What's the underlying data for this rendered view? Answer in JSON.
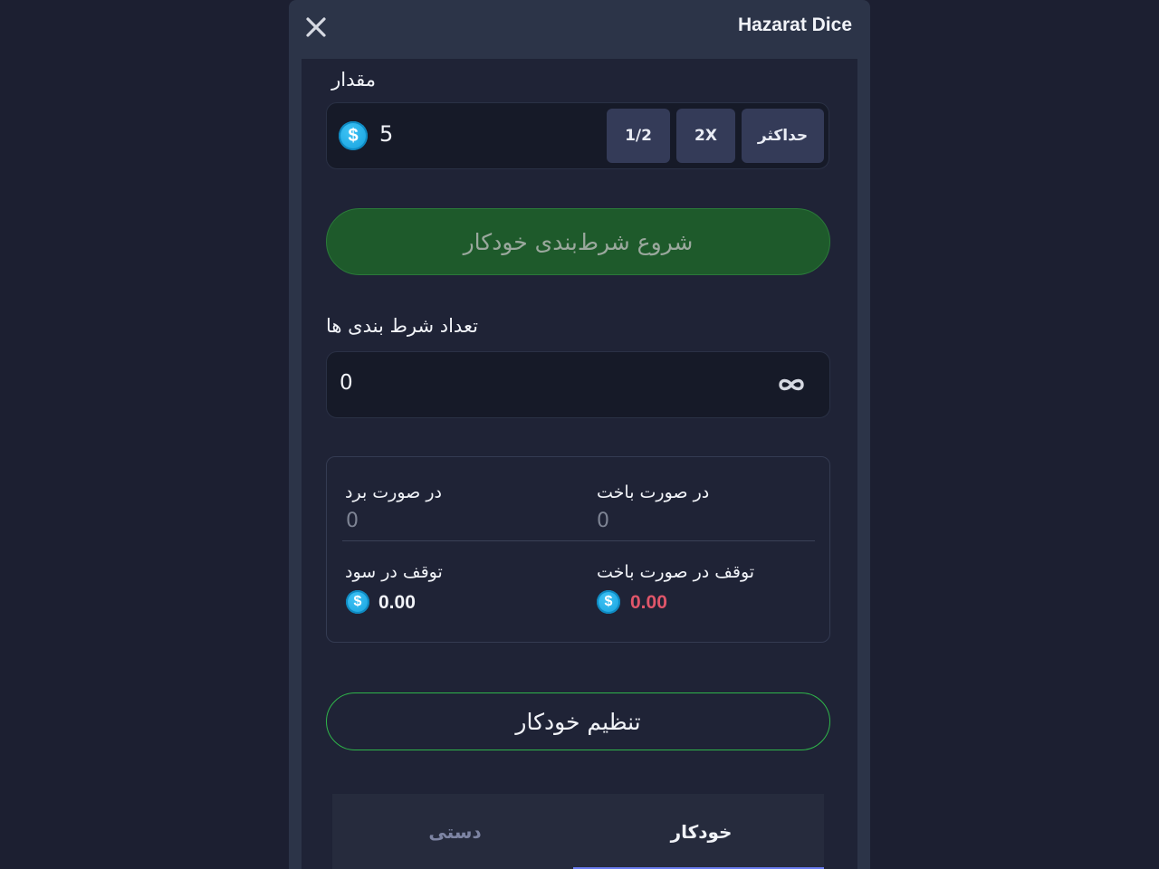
{
  "header": {
    "title": "Hazarat Dice"
  },
  "amount": {
    "label": "مقدار",
    "value": "5",
    "coin_symbol": "$",
    "half_label": "1/2",
    "double_label": "2X",
    "max_label": "حداکثر"
  },
  "start_button": {
    "label": "شروع شرط‌بندی خودکار"
  },
  "bet_count": {
    "label": "تعداد شرط بندی ها",
    "value": "0"
  },
  "auto_settings": {
    "on_win_label": "در صورت برد",
    "on_win_value": "0",
    "on_loss_label": "در صورت باخت",
    "on_loss_value": "0",
    "stop_profit_label": "توقف در سود",
    "stop_profit_value": "0.00",
    "stop_loss_label": "توقف در صورت باخت",
    "stop_loss_value": "0.00"
  },
  "configure_button": {
    "label": "تنظیم خودکار"
  },
  "tabs": [
    {
      "label": "دستی",
      "active": false
    },
    {
      "label": "خودکار",
      "active": true
    }
  ],
  "colors": {
    "loss_value": "#e0566a",
    "accent_green": "#2fb54a",
    "coin_blue": "#139fdc"
  }
}
